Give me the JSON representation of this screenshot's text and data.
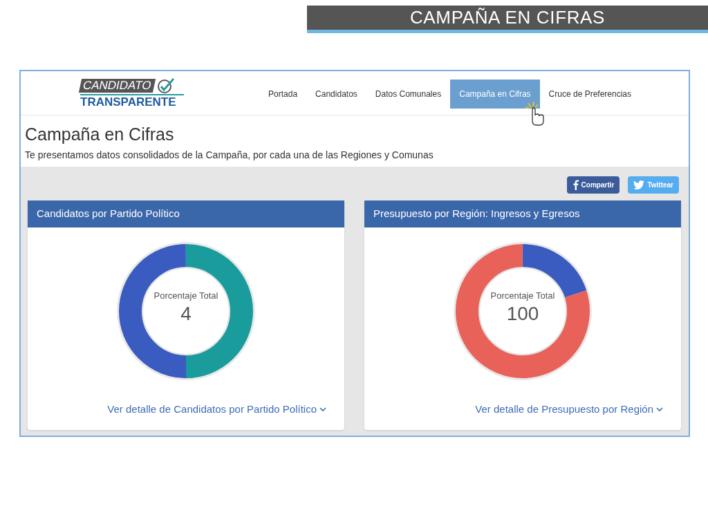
{
  "slide_title": "CAMPAÑA EN CIFRAS",
  "logo": {
    "line_1": "CANDIDATO",
    "line_2": "TRANSPARENTE"
  },
  "nav": [
    {
      "label": "Portada",
      "selected": false
    },
    {
      "label": "Candidatos",
      "selected": false
    },
    {
      "label": "Datos Comunales",
      "selected": false
    },
    {
      "label": "Campaña en Cifras",
      "selected": true
    },
    {
      "label": "Cruce de Preferencias",
      "selected": false
    }
  ],
  "page": {
    "title": "Campaña en Cifras",
    "subtitle": "Te presentamos datos consolidados de la Campaña, por cada una de las Regiones y Comunas"
  },
  "share_buttons": [
    {
      "kind": "facebook",
      "label": "Compartir"
    },
    {
      "kind": "twitter",
      "label": "Twittear"
    }
  ],
  "cards": [
    {
      "title": "Candidatos por Partido Político",
      "center_label": "Porcentaje Total",
      "center_value": "4",
      "link": "Ver detalle de Candidatos por Partido Político"
    },
    {
      "title": "Presupuesto por Región: Ingresos y Egresos",
      "center_label": "Porcentaje Total",
      "center_value": "100",
      "link": "Ver detalle de Presupuesto por Región"
    }
  ]
}
